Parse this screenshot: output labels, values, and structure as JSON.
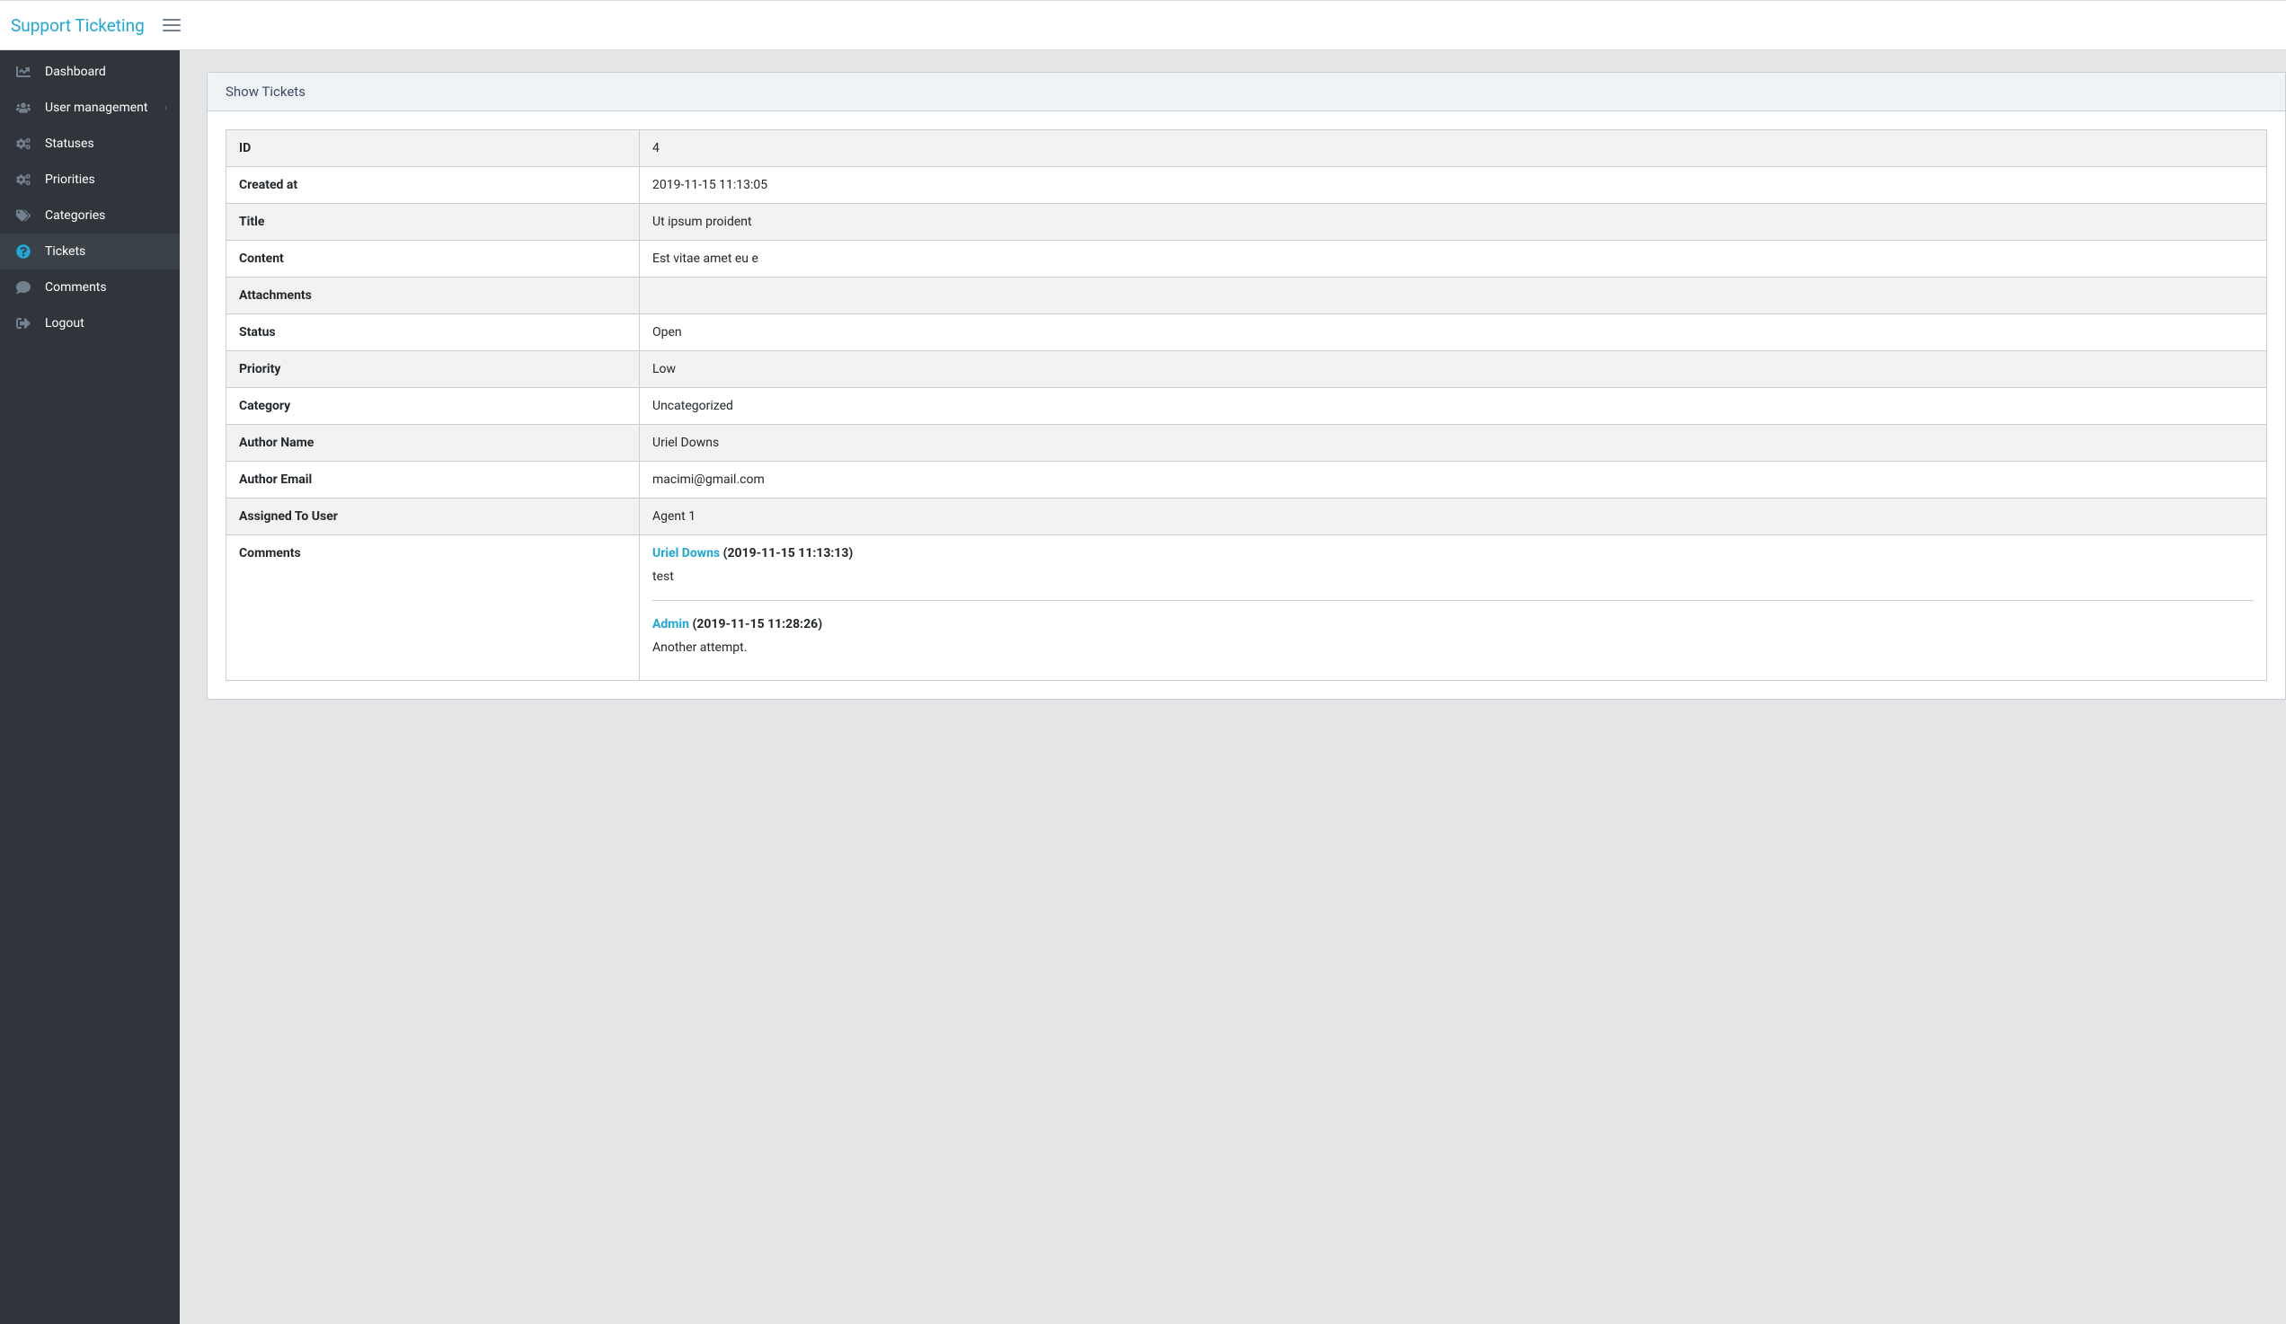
{
  "brand": "Support Ticketing",
  "sidebar": {
    "items": [
      {
        "label": "Dashboard",
        "icon": "dashboard",
        "active": false,
        "caret": false
      },
      {
        "label": "User management",
        "icon": "users",
        "active": false,
        "caret": true
      },
      {
        "label": "Statuses",
        "icon": "cogs",
        "active": false,
        "caret": false
      },
      {
        "label": "Priorities",
        "icon": "cogs",
        "active": false,
        "caret": false
      },
      {
        "label": "Categories",
        "icon": "tags",
        "active": false,
        "caret": false
      },
      {
        "label": "Tickets",
        "icon": "question",
        "active": true,
        "caret": false
      },
      {
        "label": "Comments",
        "icon": "comment",
        "active": false,
        "caret": false
      },
      {
        "label": "Logout",
        "icon": "logout",
        "active": false,
        "caret": false
      }
    ]
  },
  "card": {
    "header": "Show Tickets"
  },
  "fields": {
    "id": {
      "label": "ID",
      "value": "4"
    },
    "created_at": {
      "label": "Created at",
      "value": "2019-11-15 11:13:05"
    },
    "title": {
      "label": "Title",
      "value": "Ut ipsum proident"
    },
    "content": {
      "label": "Content",
      "value": "Est vitae amet eu e"
    },
    "attachments": {
      "label": "Attachments",
      "value": ""
    },
    "status": {
      "label": "Status",
      "value": "Open"
    },
    "priority": {
      "label": "Priority",
      "value": "Low"
    },
    "category": {
      "label": "Category",
      "value": "Uncategorized"
    },
    "author_name": {
      "label": "Author Name",
      "value": "Uriel Downs"
    },
    "author_email": {
      "label": "Author Email",
      "value": "macimi@gmail.com"
    },
    "assigned_to": {
      "label": "Assigned To User",
      "value": "Agent 1"
    },
    "comments_label": "Comments"
  },
  "comments": [
    {
      "author": "Uriel Downs",
      "timestamp": "(2019-11-15 11:13:13)",
      "body": "test"
    },
    {
      "author": "Admin",
      "timestamp": "(2019-11-15 11:28:26)",
      "body": "Another attempt."
    }
  ]
}
